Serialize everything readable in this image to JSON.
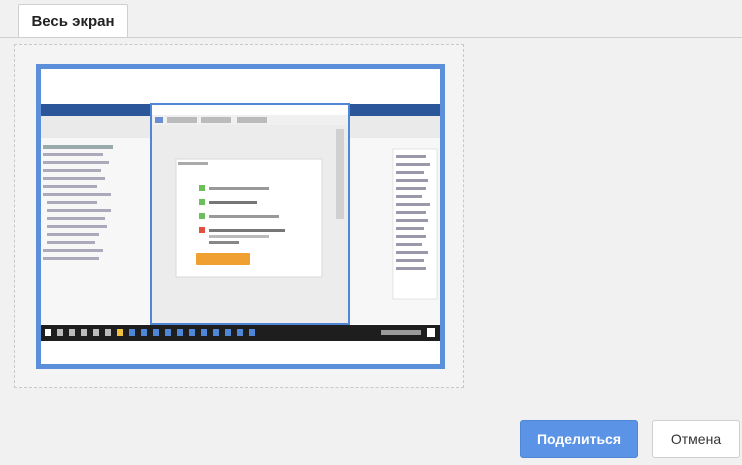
{
  "tab": {
    "label": "Весь экран"
  },
  "buttons": {
    "share": "Поделиться",
    "cancel": "Отмена"
  },
  "colors": {
    "accent": "#5b93e6",
    "thumbnail_border": "#5b8fd9",
    "orange_button": "#f0a030"
  }
}
